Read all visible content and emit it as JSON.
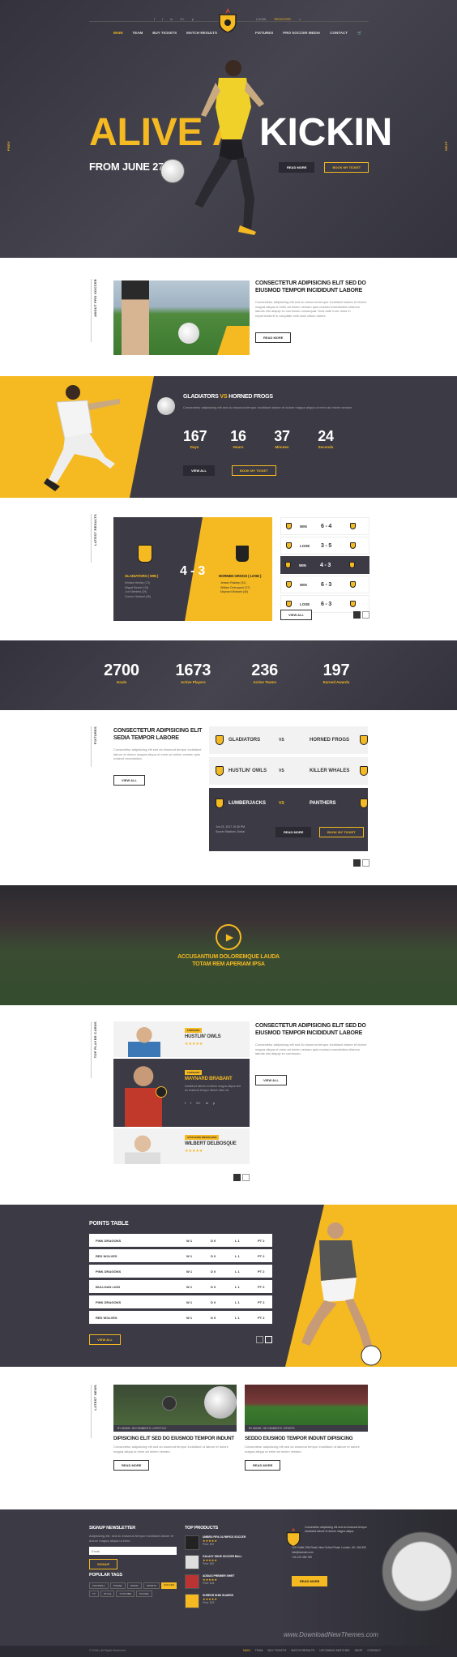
{
  "nav": {
    "social": [
      "f",
      "t",
      "in",
      "G+",
      "p"
    ],
    "login": "LOGIN",
    "register": "REGISTER",
    "left": [
      "MAIN",
      "TEAM",
      "BUY TICKETS",
      "MATCH RESULTS"
    ],
    "right": [
      "FIXTURES",
      "PRO SOCCER MEDIA",
      "CONTACT"
    ]
  },
  "hero": {
    "title_left": "ALIVE A",
    "title_right": "KICKIN",
    "date": "FROM JUNE 27",
    "btn_more": "READ MORE",
    "btn_ticket": "BOOK MY TICKET",
    "side_left": "PREV",
    "side_right": "NEXT"
  },
  "about": {
    "side": "ABOUT PRO SOCCER",
    "title": "CONSECTETUR ADIPISICING ELIT SED DO EIUSMOD TEMPOR INCIDIDUNT LABORE",
    "text": "Consectetur adipisicing elit sed do eiusmod tempor incididunt labore et dolore magna aliqua ut enim ad minim veniam quis nostrud exercitation ullamco laboris nisi aliquip ex commodo consequat. Duis aute irure dolor in reprehenderit in voluptate velit esse cillum dolore.",
    "btn": "READ MORE"
  },
  "countdown": {
    "team1": "GLADIATORS",
    "vs": "VS",
    "team2": "HORNED FROGS",
    "text": "Consectetur adipisicing elit sed do eiusmod tempor incididunt labore et dolore magna aliqua ut enim ad minim veniam",
    "items": [
      {
        "n": "167",
        "l": "Days"
      },
      {
        "n": "16",
        "l": "Hours"
      },
      {
        "n": "37",
        "l": "Minutes"
      },
      {
        "n": "24",
        "l": "Seconds"
      }
    ],
    "btn_all": "VIEW ALL",
    "btn_ticket": "BOOK MY TICKET"
  },
  "results": {
    "side": "LATEST RESULTS",
    "score": "4 - 3",
    "home": "GLADIATORS ( WIN )",
    "away": "HORNED GROGS ( LOSE )",
    "home_players": [
      "Kristian Henley (73)",
      "Miguel Becket (19)",
      "Jon Kleinfeld (29)",
      "Connor Harland (45)"
    ],
    "away_players": [
      "Jensen Rakeep (51)",
      "William Debosquet (37)",
      "Maynard Brabant (46)"
    ],
    "rows": [
      {
        "res": "WIN",
        "score": "6 - 4"
      },
      {
        "res": "LOSE",
        "score": "3 - 5"
      },
      {
        "res": "WIN",
        "score": "4 - 3"
      },
      {
        "res": "WIN",
        "score": "6 - 3"
      },
      {
        "res": "LOSE",
        "score": "6 - 3"
      }
    ],
    "btn": "VIEW ALL"
  },
  "stats": [
    {
      "n": "2700",
      "l": "Goals"
    },
    {
      "n": "1673",
      "l": "Active Players"
    },
    {
      "n": "236",
      "l": "Active Teams"
    },
    {
      "n": "197",
      "l": "Earned Awards"
    }
  ],
  "fixtures": {
    "side": "FIXTURES",
    "title": "CONSECTETUR ADIPISICING ELIT SEDIA TEMPOR LABORE",
    "text": "Consectetur adipisicing elit sed do eiusmod tempor incididunt labore et dolore magna aliqua ut enim ad minim veniam quis nostrud exercitation.",
    "btn": "VIEW ALL",
    "matches": [
      {
        "a": "GLADIATORS",
        "b": "HORNED FROGS"
      },
      {
        "a": "HUSTLIN' OWLS",
        "b": "KILLER WHALES"
      },
      {
        "a": "LUMBERJACKS",
        "b": "PANTHERS"
      }
    ],
    "vs": "VS",
    "date": "Jun 15, 2017  10:30 PM",
    "venue": "Soccer Stadium, Dubai",
    "btn_more": "READ MORE",
    "btn_ticket": "BOOK MY TICKET"
  },
  "video": {
    "line1": "ACCUSANTIUM DOLOREMQUE LAUDA",
    "line2": "TOTAM REM APERIAM IPSA"
  },
  "players": {
    "side": "TOP PLAYER CARDS",
    "cards": [
      {
        "tag": "FORWARD",
        "name": "HUSTLIN' OWLS"
      },
      {
        "tag": "FORWARD",
        "name": "MAYNARD BRABANT",
        "text": "Incididunt labore et dolore magna aliqua sed do eiusmod tempor labore dolor sit."
      },
      {
        "tag": "ATTACKING MIDFIELDER",
        "name": "WILBERT DELBOSQUE"
      }
    ],
    "title": "CONSECTETUR ADIPISICING ELIT SED DO EIUSMOD TEMPOR INCIDIDUNT LABORE",
    "text": "Consectetur adipisicing elit sed do eiusmod tempor incididunt labore et dolore magna aliqua ut enim ad minim veniam quis nostrud exercitation ullamco laboris nisi aliquip ex commodo.",
    "btn": "VIEW ALL"
  },
  "points": {
    "title": "POINTS TABLE",
    "rows": [
      [
        "PINK DRAGONS",
        "W 1",
        "D 0",
        "L 1",
        "PT 2"
      ],
      [
        "RED WOLVES",
        "W 1",
        "D 0",
        "L 1",
        "PT 2"
      ],
      [
        "PINK DRAGONS",
        "W 1",
        "D 0",
        "L 1",
        "PT 2"
      ],
      [
        "BULLHAN LION",
        "W 1",
        "D 0",
        "L 1",
        "PT 2"
      ],
      [
        "PINK DRAGONS",
        "W 1",
        "D 0",
        "L 1",
        "PT 2"
      ],
      [
        "RED WOLVES",
        "W 1",
        "D 0",
        "L 1",
        "PT 2"
      ]
    ],
    "btn": "VIEW ALL"
  },
  "news": {
    "side": "LATEST NEWS",
    "items": [
      {
        "meta": "BY ADMIN  /  08 COMMENTS  /  LIFESTYLE",
        "title": "DIPISICING ELIT SED DO EIUSMOD TEMPOR INDUNT",
        "text": "Consectetur adipisicing elit sed do eiusmod tempor incididunt ut labore et dolore magna aliqua ut enim ad minim veniam.",
        "btn": "READ MORE"
      },
      {
        "meta": "BY ADMIN  /  08 COMMENTS  /  SPORTS",
        "title": "SEDDO EIUSMOD TEMPOR INDUNT DIPISICING",
        "text": "Consectetur adipisicing elit sed do eiusmod tempor incididunt ut labore et dolore magna aliqua ut enim ad minim veniam.",
        "btn": "READ MORE"
      }
    ]
  },
  "footer": {
    "signup_title": "SIGNUP NEWSLETTER",
    "signup_text": "Adipisicing elit, sed do eiusmod tempor incididunt labore et dolore magna aliqua ut enim.",
    "email_ph": "Email",
    "signup_btn": "SIGNUP",
    "tags_title": "POPULAR TAGS",
    "tags": [
      "FOOTBALL",
      "TRAVEL",
      "MUSIC",
      "SPORTS",
      "SOCCER",
      "TV",
      "STYLE",
      "YOUTUBE",
      "PLAYER"
    ],
    "products_title": "TOP PRODUCTS",
    "products": [
      {
        "name": "UMBRO FIFA OLYMPICS SOCCER",
        "price": "Price: $67"
      },
      {
        "name": "GALAXY SHOE SOCCER BALL",
        "price": "Price: $87"
      },
      {
        "name": "ADIDAS PREMIER SHIRT",
        "price": "Price: $44"
      },
      {
        "name": "SUREGR SHIN GUARDS",
        "price": "Price: $29"
      }
    ],
    "about": "Consectetur adipisicing elit sed do eiusmod tempor incididunt labore et dolore magna aliqua.",
    "addr": "123 Outlet 23th Road, New Oxford Road, London, UK, WA 392",
    "email": "info@domain.com",
    "phone": "+44 123 456 789",
    "btn": "READ MORE",
    "watermark": "www.DownloadNewThemes.com",
    "copy": "© 2015  |  All Rights Reserved",
    "links": [
      "MAIN",
      "TEAM",
      "BUY TICKETS",
      "MATCH RESULTS",
      "UPCOMING MATCHES",
      "SHOP",
      "CONTACT"
    ]
  },
  "colors": {
    "accent": "#f5b921",
    "dark": "#3b3a45"
  }
}
